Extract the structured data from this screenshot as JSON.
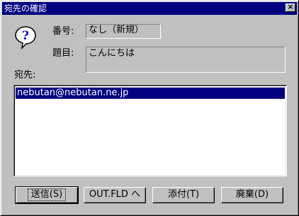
{
  "window": {
    "title": "宛先の確認",
    "close_glyph": "×"
  },
  "fields": {
    "number_label": "番号:",
    "number_value": "なし（新規）",
    "subject_label": "題目:",
    "subject_value": "こんにちは"
  },
  "recipients": {
    "label": "宛先:",
    "items": [
      "nebutan@nebutan.ne.jp"
    ]
  },
  "buttons": {
    "send": "送信(S)",
    "outfld": "OUT.FLD へ",
    "attach": "添付(T)",
    "discard": "廃棄(D)"
  },
  "colors": {
    "face": "#c0c0c0",
    "titlebar": "#000080",
    "selection": "#000080"
  },
  "icons": {
    "dialog": "question-icon",
    "close": "close-icon"
  }
}
